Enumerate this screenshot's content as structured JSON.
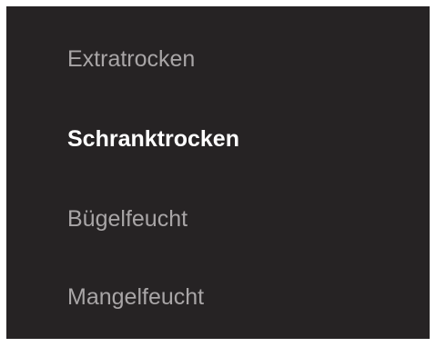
{
  "menu": {
    "items": [
      {
        "label": "Extratrocken",
        "selected": false
      },
      {
        "label": "Schranktrocken",
        "selected": true
      },
      {
        "label": "Bügelfeucht",
        "selected": false
      },
      {
        "label": "Mangelfeucht",
        "selected": false
      }
    ]
  },
  "colors": {
    "screen_background": "#262324",
    "selected_text": "#ffffff",
    "unselected_text": "#a8a5a6",
    "frame": "#ffffff"
  }
}
